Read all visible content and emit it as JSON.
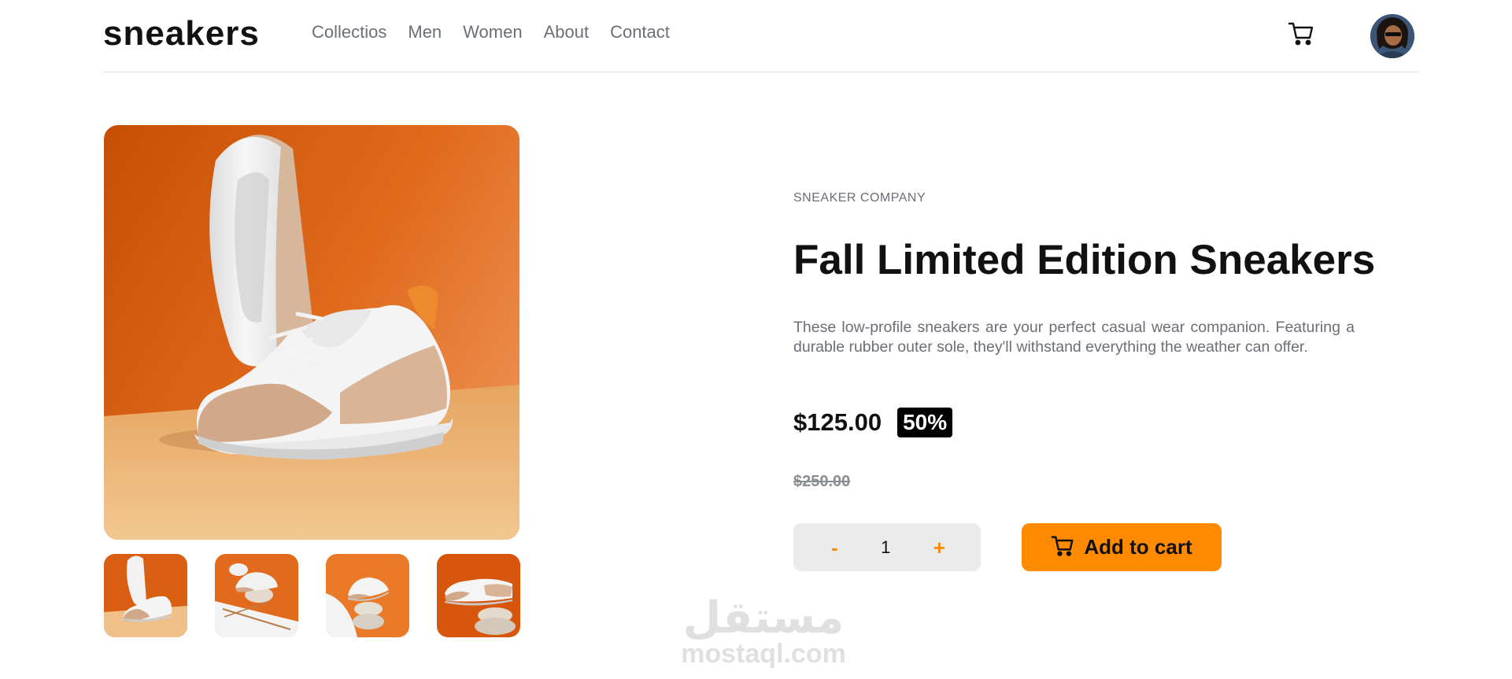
{
  "header": {
    "logo": "sneakers",
    "nav": [
      "Collectios",
      "Men",
      "Women",
      "About",
      "Contact"
    ],
    "cart_icon": "cart-icon",
    "avatar_icon": "user-avatar"
  },
  "gallery": {
    "main_image": "product-image-1",
    "thumbnails": [
      "product-thumbnail-1",
      "product-thumbnail-2",
      "product-thumbnail-3",
      "product-thumbnail-4"
    ]
  },
  "product": {
    "company": "SNEAKER COMPANY",
    "title": "Fall Limited Edition Sneakers",
    "description": "These low-profile sneakers are your perfect casual wear companion. Featuring a durable rubber outer sole, they'll withstand everything the weather can offer.",
    "price": "$125.00",
    "discount": "50%",
    "old_price": "$250.00"
  },
  "cart_controls": {
    "minus": "-",
    "quantity": "1",
    "plus": "+",
    "add_to_cart": "Add to cart"
  },
  "watermark": {
    "arabic": "مستقل",
    "latin": "mostaql.com"
  },
  "colors": {
    "accent": "#ff8a00",
    "text_dark": "#111111",
    "text_muted": "#6b6f76",
    "quantity_bg": "#ebebeb"
  }
}
